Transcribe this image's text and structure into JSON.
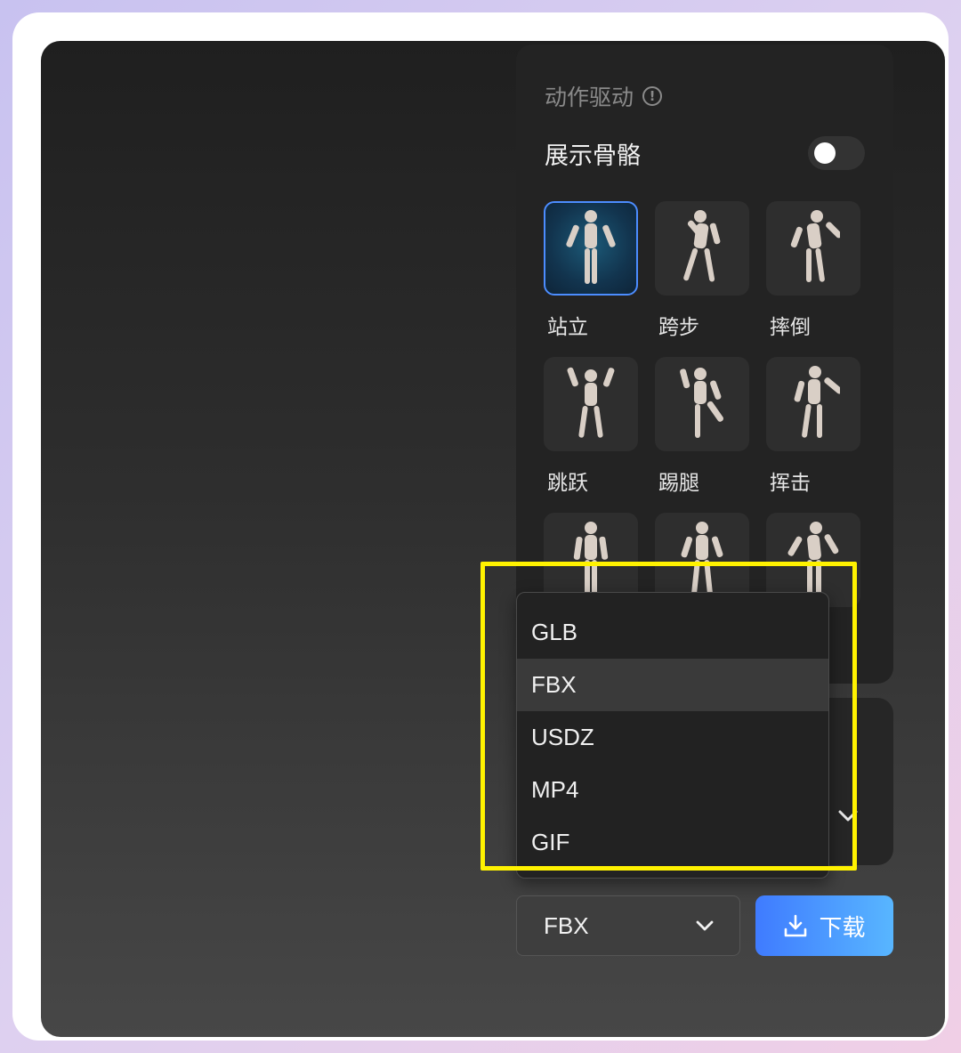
{
  "panel": {
    "title": "动作驱动",
    "info_icon": "info-circle-icon",
    "skeleton_label": "展示骨骼",
    "skeleton_toggle_on": false
  },
  "motions": [
    {
      "label": "站立",
      "icon": "pose-standing-icon",
      "selected": true
    },
    {
      "label": "跨步",
      "icon": "pose-stride-icon",
      "selected": false
    },
    {
      "label": "摔倒",
      "icon": "pose-fall-icon",
      "selected": false
    },
    {
      "label": "跳跃",
      "icon": "pose-jump-icon",
      "selected": false
    },
    {
      "label": "踢腿",
      "icon": "pose-kick-icon",
      "selected": false
    },
    {
      "label": "挥击",
      "icon": "pose-swing-icon",
      "selected": false
    },
    {
      "label": "",
      "icon": "pose-icon",
      "selected": false
    },
    {
      "label": "",
      "icon": "pose-icon",
      "selected": false
    },
    {
      "label": "",
      "icon": "pose-icon",
      "selected": false
    }
  ],
  "format_dropdown": {
    "options": [
      "GLB",
      "FBX",
      "USDZ",
      "MP4",
      "GIF"
    ],
    "highlighted": "FBX"
  },
  "format_select": {
    "value": "FBX",
    "icon": "chevron-down-icon"
  },
  "download": {
    "label": "下载",
    "icon": "download-icon"
  },
  "colors": {
    "accent_blue": "#3f7bff",
    "highlight_box": "#fff200",
    "panel_bg": "#232323"
  }
}
